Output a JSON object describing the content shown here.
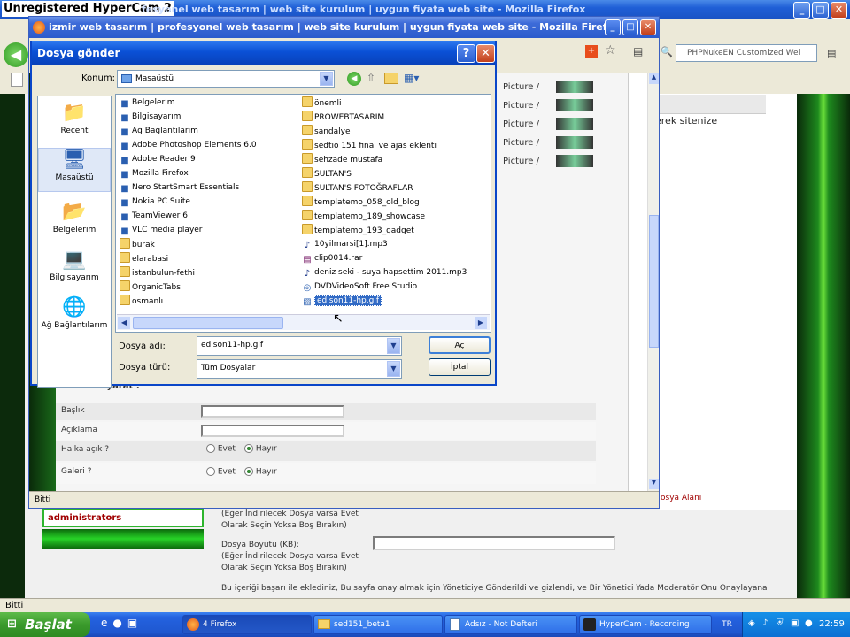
{
  "outer": {
    "hypercam": "Unregistered HyperCam 2",
    "title_tail": "fesyonel web tasarım | web site kurulum | uygun fiyata web site - Mozilla Firefox",
    "status": "Bitti",
    "search_placeholder": "PHPNukeEN Customized Wel"
  },
  "firefox": {
    "title": "izmir web tasarım | profesyonel web tasarım | web site kurulum | uygun fiyata web site - Mozilla Firefox",
    "status": "Bitti",
    "picture_label": "Picture /",
    "text_snippet": "erek sitenize"
  },
  "page": {
    "yeni_dizin": "Yeni dizin yarat :",
    "baslik": "Başlık",
    "aciklama": "Açıklama",
    "halka_acik": "Halka açık ?",
    "galeri": "Galeri ?",
    "evet": "Evet",
    "hayir": "Hayır",
    "administrators": "administrators",
    "dosya_alani": "osya Alanı",
    "indirilecek1": "(Eğer İndirilecek Dosya varsa Evet",
    "olarak1": "Olarak Seçin Yoksa Boş Bırakın)",
    "dosya_boyutu": "Dosya Boyutu (KB):",
    "indirilecek2": "(Eğer İndirilecek Dosya varsa Evet",
    "olarak2": "Olarak Seçin Yoksa Boş Bırakın)",
    "notice": "Bu içeriği başarı ile eklediniz, Bu sayfa onay almak için Yöneticiye Gönderildi ve gizlendi, ve Bir Yönetici Yada Moderatör Onu Onaylayana"
  },
  "dialog": {
    "title": "Dosya gönder",
    "konum_label": "Konum:",
    "konum_value": "Masaüstü",
    "places": [
      "Recent",
      "Masaüstü",
      "Belgelerim",
      "Bilgisayarım",
      "Ağ Bağlantılarım"
    ],
    "col1": [
      "Belgelerim",
      "Bilgisayarım",
      "Ağ Bağlantılarım",
      "Adobe Photoshop Elements 6.0",
      "Adobe Reader 9",
      "Mozilla Firefox",
      "Nero StartSmart Essentials",
      "Nokia PC Suite",
      "TeamViewer 6",
      "VLC media player",
      "burak",
      "elarabasi",
      "istanbulun-fethi",
      "OrganicTabs",
      "osmanlı"
    ],
    "col2": [
      "önemli",
      "PROWEBTASARIM",
      "sandalye",
      "sedtio 151 final ve ajas eklenti",
      "sehzade mustafa",
      "SULTAN'S",
      "SULTAN'S FOTOĞRAFLAR",
      "templatemo_058_old_blog",
      "templatemo_189_showcase",
      "templatemo_193_gadget",
      "10yilmarsi[1].mp3",
      "clip0014.rar",
      "deniz seki - suya hapsettim 2011.mp3",
      "DVDVideoSoft Free Studio",
      "edison11-hp.gif"
    ],
    "filename_label": "Dosya adı:",
    "filename_value": "edison11-hp.gif",
    "filetype_label": "Dosya türü:",
    "filetype_value": "Tüm Dosyalar",
    "open_button": "Aç",
    "cancel_button": "İptal"
  },
  "taskbar": {
    "start": "Başlat",
    "tasks": [
      "4 Firefox",
      "sed151_beta1",
      "Adsız - Not Defteri",
      "HyperCam - Recording"
    ],
    "lang": "TR",
    "clock": "22:59"
  }
}
